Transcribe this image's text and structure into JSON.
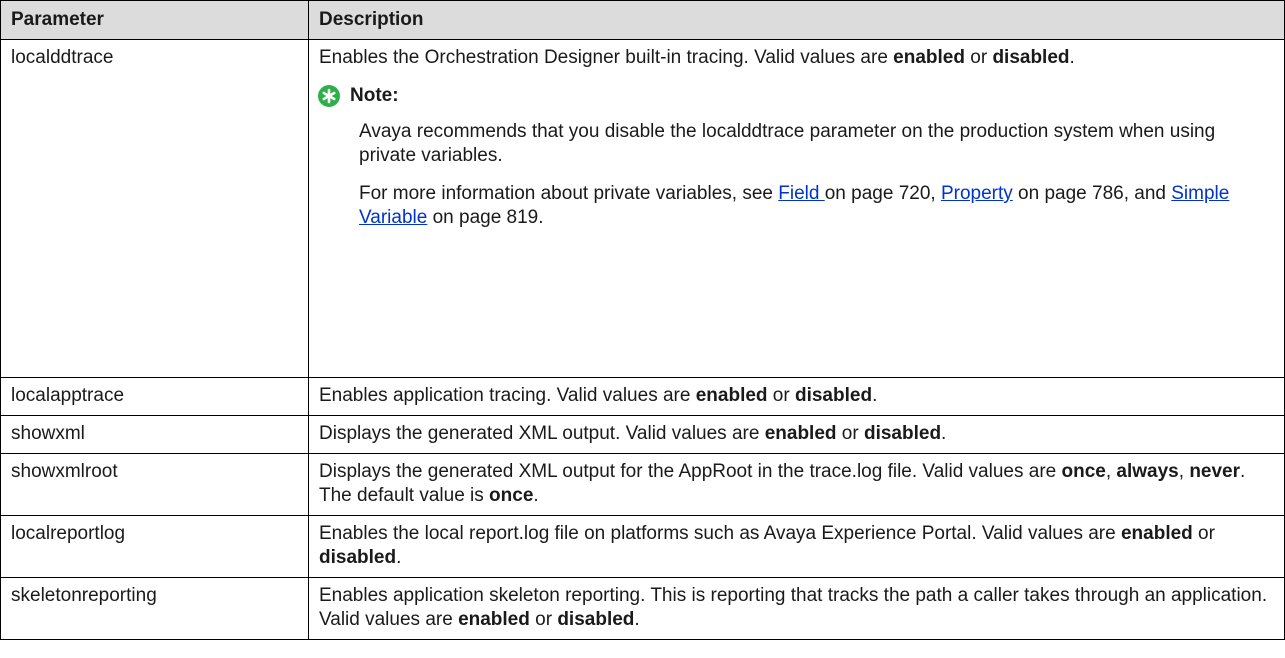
{
  "table": {
    "headers": [
      "Parameter",
      "Description"
    ],
    "row1": {
      "param": "localddtrace",
      "desc": {
        "t1": "Enables the Orchestration Designer built-in tracing. Valid values are ",
        "b1": "enabled",
        "t2": " or ",
        "b2": "disabled",
        "t3": "."
      },
      "note": {
        "title": "Note:",
        "icon": "star-badge-icon",
        "icon_color": "#2db04a",
        "p1": "Avaya recommends that you disable the localddtrace parameter on the production system when using private variables.",
        "p2": {
          "t1": "For more information about private variables, see ",
          "link1": "Field ",
          "t2": " on page 720, ",
          "link2": "Property",
          "t3": " on page 786, and ",
          "link3": "Simple Variable",
          "t4": " on page 819."
        }
      }
    },
    "row2": {
      "param": "localapptrace",
      "t1": "Enables application tracing. Valid values are ",
      "b1": "enabled",
      "t2": " or ",
      "b2": "disabled",
      "t3": "."
    },
    "row3": {
      "param": "showxml",
      "t1": "Displays the generated XML output. Valid values are ",
      "b1": "enabled",
      "t2": " or ",
      "b2": "disabled",
      "t3": "."
    },
    "row4": {
      "param": "showxmlroot",
      "t1": "Displays the generated XML output for the AppRoot in the trace.log file. Valid values are ",
      "b1": "once",
      "t2": ", ",
      "b2": "always",
      "t3": ", ",
      "b3": "never",
      "t4": ". The default value is ",
      "b4": "once",
      "t5": "."
    },
    "row5": {
      "param": "localreportlog",
      "t1": "Enables the local report.log file on platforms such as Avaya Experience Portal. Valid values are ",
      "b1": "enabled",
      "t2": " or ",
      "b2": "disabled",
      "t3": "."
    },
    "row6": {
      "param": "skeletonreporting",
      "t1": "Enables application skeleton reporting. This is reporting that tracks the path a caller takes through an application. Valid values are ",
      "b1": "enabled",
      "t2": " or ",
      "b2": "disabled",
      "t3": "."
    }
  },
  "colors": {
    "header_bg": "#dcdcdc",
    "link": "#0033cc"
  }
}
